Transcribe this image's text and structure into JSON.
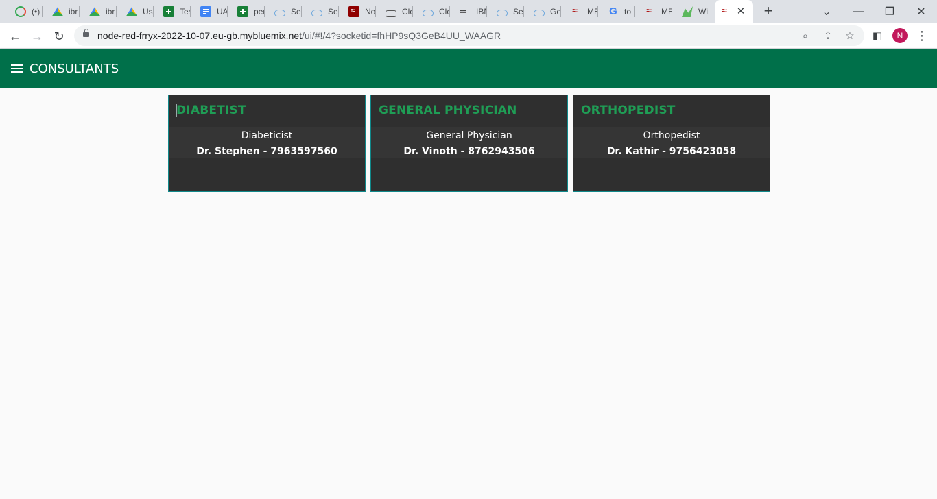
{
  "browser": {
    "tabs": [
      {
        "title": "(•)",
        "icon": "loading-icon"
      },
      {
        "title": "ibr",
        "icon": "google-drive-icon"
      },
      {
        "title": "ibr",
        "icon": "google-drive-icon"
      },
      {
        "title": "Us",
        "icon": "google-drive-icon"
      },
      {
        "title": "Tes",
        "icon": "google-sheets-icon"
      },
      {
        "title": "UA",
        "icon": "google-docs-icon"
      },
      {
        "title": "per",
        "icon": "google-sheets-icon"
      },
      {
        "title": "Ser",
        "icon": "cloud-icon"
      },
      {
        "title": "Ser",
        "icon": "cloud-icon"
      },
      {
        "title": "No",
        "icon": "node-red-icon"
      },
      {
        "title": "Clo",
        "icon": "lock-icon"
      },
      {
        "title": "Clo",
        "icon": "cloud-icon"
      },
      {
        "title": "IBM",
        "icon": "ibm-icon"
      },
      {
        "title": "Ser",
        "icon": "cloud-icon"
      },
      {
        "title": "Ge",
        "icon": "cloud-icon"
      },
      {
        "title": "ME",
        "icon": "node-red-icon"
      },
      {
        "title": "to",
        "icon": "google-icon"
      },
      {
        "title": "ME",
        "icon": "node-red-icon"
      },
      {
        "title": "Wi",
        "icon": "green-logo-icon"
      },
      {
        "title": "",
        "icon": "node-red-icon",
        "active": true
      }
    ],
    "url_host": "node-red-frryx-2022-10-07.eu-gb.mybluemix.net",
    "url_path": "/ui/#!/4?socketid=fhHP9sQ3GeB4UU_WAAGR",
    "profile_initial": "N"
  },
  "app": {
    "title": "CONSULTANTS"
  },
  "cards": [
    {
      "title": "DIABETIST",
      "specialty": "Diabeticist",
      "doctor": "Dr. Stephen - 7963597560"
    },
    {
      "title": "GENERAL PHYSICIAN",
      "specialty": "General Physician",
      "doctor": "Dr. Vinoth - 8762943506"
    },
    {
      "title": "ORTHOPEDIST",
      "specialty": "Orthopedist",
      "doctor": "Dr. Kathir - 9756423058"
    }
  ],
  "colors": {
    "header": "#00704a",
    "card_bg": "#2f2f2f",
    "card_border": "#10888a",
    "card_title": "#1f9d55"
  }
}
